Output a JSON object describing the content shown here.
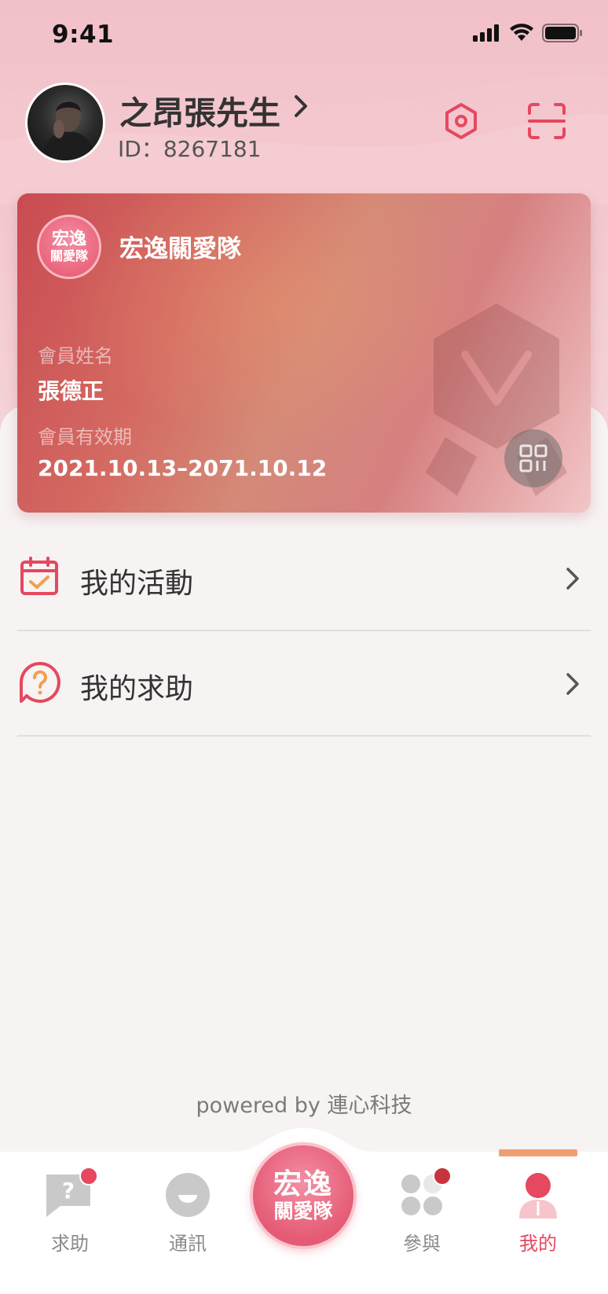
{
  "status_bar": {
    "time": "9:41"
  },
  "profile": {
    "name": "之昂張先生",
    "id_text": "ID：8267181"
  },
  "card": {
    "logo_top": "宏逸",
    "logo_bottom": "關愛隊",
    "team_name": "宏逸關愛隊",
    "member_name_label": "會員姓名",
    "member_name": "張德正",
    "validity_label": "會員有效期",
    "validity": "2021.10.13–2071.10.12"
  },
  "menu": [
    {
      "label": "我的活動",
      "icon": "calendar-check-icon"
    },
    {
      "label": "我的求助",
      "icon": "question-bubble-icon"
    }
  ],
  "footer": {
    "powered_by": "powered by 連心科技"
  },
  "tabs": [
    {
      "label": "求助",
      "icon": "help-chat-icon",
      "badge": true
    },
    {
      "label": "通訊",
      "icon": "chat-smile-icon",
      "badge": false
    },
    {
      "label": "參與",
      "icon": "clover-grid-icon",
      "badge": true
    },
    {
      "label": "我的",
      "icon": "person-icon",
      "badge": false,
      "active": true
    }
  ],
  "center_tab": {
    "top": "宏逸",
    "bottom": "關愛隊"
  },
  "colors": {
    "accent": "#e5485f",
    "active_bar": "#f0a070",
    "header_bg": "#f2c0c8"
  }
}
